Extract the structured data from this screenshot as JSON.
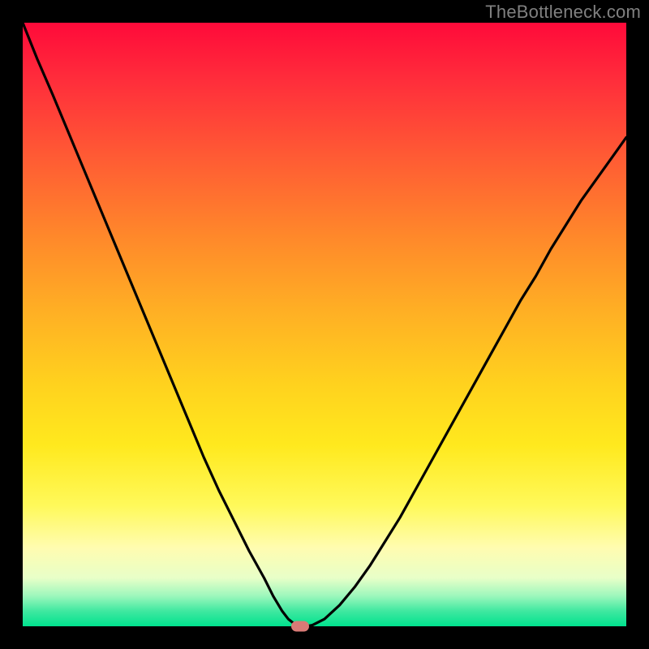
{
  "watermark": "TheBottleneck.com",
  "colors": {
    "frame": "#000000",
    "curve": "#000000",
    "marker": "#d97a76",
    "gradient_top": "#ff0a3a",
    "gradient_bottom": "#00e28e"
  },
  "chart_data": {
    "type": "line",
    "title": "",
    "xlabel": "",
    "ylabel": "",
    "xlim": [
      0,
      100
    ],
    "ylim": [
      0,
      100
    ],
    "grid": false,
    "legend": false,
    "x": [
      0,
      2.4,
      5,
      7.5,
      10,
      12.5,
      15,
      17.5,
      20,
      22.5,
      25,
      27.5,
      30,
      32.5,
      35,
      37.5,
      40,
      41.5,
      43,
      44,
      45,
      46,
      47,
      48,
      50,
      52.5,
      55,
      57.5,
      60,
      62.5,
      65,
      67.5,
      70,
      72.5,
      75,
      77.5,
      80,
      82.5,
      85,
      87.5,
      90,
      92.5,
      95,
      97.5,
      100
    ],
    "values": [
      100,
      94,
      88,
      82,
      76,
      70,
      64,
      58,
      52,
      46,
      40,
      34,
      28,
      22.5,
      17.5,
      12.5,
      8,
      5,
      2.5,
      1.2,
      0.4,
      0,
      0,
      0.2,
      1.2,
      3.5,
      6.5,
      10,
      14,
      18,
      22.5,
      27,
      31.5,
      36,
      40.5,
      45,
      49.5,
      54,
      58,
      62.5,
      66.5,
      70.5,
      74,
      77.5,
      81
    ],
    "marker": {
      "x": 46,
      "y": 0
    },
    "note": "x and y are in percent of plot area; y=0 is bottom (green), y=100 is top (red)."
  }
}
